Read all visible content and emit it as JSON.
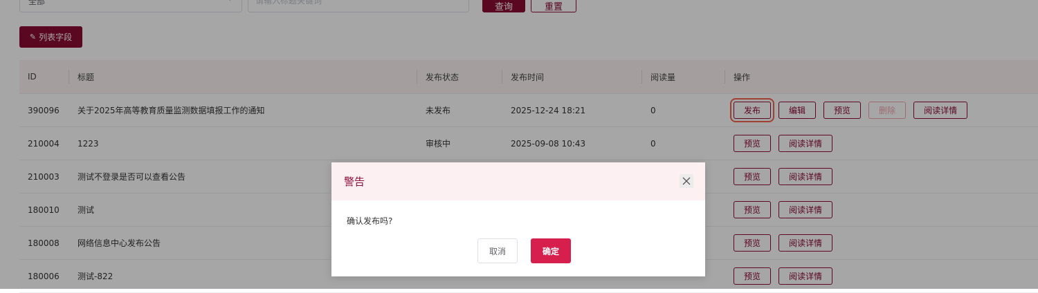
{
  "filters": {
    "category_value": "全部",
    "keyword_placeholder": "请输入标题关键词",
    "query_label": "查询",
    "reset_label": "重置"
  },
  "toolbar": {
    "fields_label": "列表字段",
    "fields_icon": "edit-icon"
  },
  "table": {
    "columns": [
      "ID",
      "标题",
      "发布状态",
      "发布时间",
      "阅读量",
      "操作"
    ],
    "rows": [
      {
        "id": "390096",
        "title": "关于2025年高等教育质量监测数据填报工作的通知",
        "status": "未发布",
        "time": "2025-12-24 18:21",
        "reads": "0",
        "actions": [
          "发布",
          "编辑",
          "预览",
          "删除",
          "阅读详情"
        ]
      },
      {
        "id": "210004",
        "title": "1223",
        "status": "审核中",
        "time": "2025-09-08 10:43",
        "reads": "0",
        "actions": [
          "预览",
          "阅读详情"
        ]
      },
      {
        "id": "210003",
        "title": "测试不登录是否可以查看公告",
        "actions": [
          "预览",
          "阅读详情"
        ]
      },
      {
        "id": "180010",
        "title": "测试",
        "actions": [
          "预览",
          "阅读详情"
        ]
      },
      {
        "id": "180008",
        "title": "网络信息中心发布公告",
        "actions": [
          "预览",
          "阅读详情"
        ]
      },
      {
        "id": "180006",
        "title": "测试-822",
        "actions": [
          "预览",
          "阅读详情"
        ]
      }
    ]
  },
  "dialog": {
    "title": "警告",
    "message": "确认发布吗?",
    "cancel_label": "取消",
    "ok_label": "确定"
  },
  "colors": {
    "primary": "#8b0b33",
    "confirm": "#d71f4d",
    "header_bg": "#fdf3f5",
    "highlight": "#f4634f",
    "disabled": "#f0a5b0"
  }
}
